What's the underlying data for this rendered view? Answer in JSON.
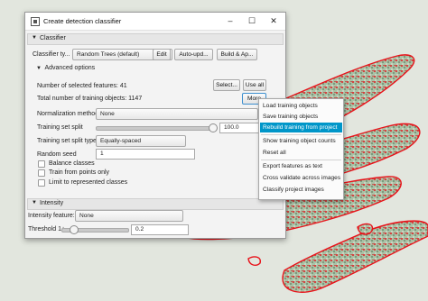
{
  "window": {
    "title": "Create detection classifier"
  },
  "classifier": {
    "section_label": "Classifier",
    "type_label": "Classifier ty...",
    "type_value": "Random Trees (default)",
    "edit_button": "Edit",
    "auto_update_button": "Auto-upd...",
    "build_button": "Build & Ap..."
  },
  "advanced": {
    "section_label": "Advanced options",
    "selected_features_text": "Number of selected features: 41",
    "select_button": "Select...",
    "use_all_button": "Use all",
    "training_objects_text": "Total number of training objects: 1147",
    "more_button": "More",
    "normalization_label": "Normalization method",
    "normalization_value": "None",
    "split_label": "Training set split",
    "split_value": "100.0",
    "split_fraction": 1.0,
    "split_type_label": "Training set split type",
    "split_type_value": "Equally-spaced",
    "seed_label": "Random seed",
    "seed_value": "1",
    "balance_label": "Balance classes",
    "train_points_label": "Train from points only",
    "limit_label": "Limit to represented classes"
  },
  "intensity": {
    "section_label": "Intensity",
    "feature_label": "Intensity feature:",
    "feature_value": "None",
    "threshold_label": "Threshold 1+",
    "threshold_value": "0.2",
    "threshold_fraction": 0.05
  },
  "context_menu": {
    "items": [
      "Load training objects",
      "Save training objects",
      "Rebuild training from project",
      "Show training object counts",
      "Reset all",
      "Export features as text",
      "Cross validate across images",
      "Classify project images"
    ],
    "selected_index": 2
  },
  "colors": {
    "accent": "#0096c9",
    "annotation": "#e8131a",
    "tissue": "#7fa07f"
  }
}
